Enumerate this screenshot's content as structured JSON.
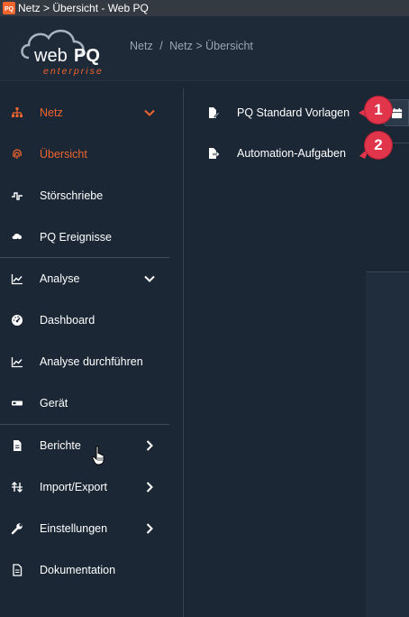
{
  "window": {
    "title": "Netz > Übersicht - Web PQ"
  },
  "logo": {
    "text_web": "web",
    "text_pq": "PQ",
    "text_sub": "enterprise"
  },
  "breadcrumb": {
    "root": "Netz",
    "separator": "/",
    "current": "Netz > Übersicht"
  },
  "sidebar": {
    "items": [
      {
        "label": "Netz",
        "icon": "sitemap-icon",
        "expanded": true
      },
      {
        "label": "Übersicht",
        "icon": "fingerprint-icon",
        "active": true
      },
      {
        "label": "Störschriebe",
        "icon": "waveform-icon"
      },
      {
        "label": "PQ Ereignisse",
        "icon": "cloud-bolt-icon"
      },
      {
        "label": "Analyse",
        "icon": "line-chart-icon",
        "expanded": true
      },
      {
        "label": "Dashboard",
        "icon": "gauge-icon"
      },
      {
        "label": "Analyse durchführen",
        "icon": "line-chart-icon"
      },
      {
        "label": "Gerät",
        "icon": "device-icon"
      },
      {
        "label": "Berichte",
        "icon": "file-icon"
      },
      {
        "label": "Import/Export",
        "icon": "arrows-icon"
      },
      {
        "label": "Einstellungen",
        "icon": "wrench-icon"
      },
      {
        "label": "Dokumentation",
        "icon": "document-icon"
      }
    ]
  },
  "submenu": {
    "items": [
      {
        "label": "PQ Standard Vorlagen",
        "icon": "file-edit-icon"
      },
      {
        "label": "Automation-Aufgaben",
        "icon": "file-export-icon"
      }
    ]
  },
  "callouts": [
    {
      "label": "1"
    },
    {
      "label": "2"
    }
  ],
  "colors": {
    "accent": "#f0642d",
    "badge": "#e0354a",
    "background": "#1b2735"
  }
}
